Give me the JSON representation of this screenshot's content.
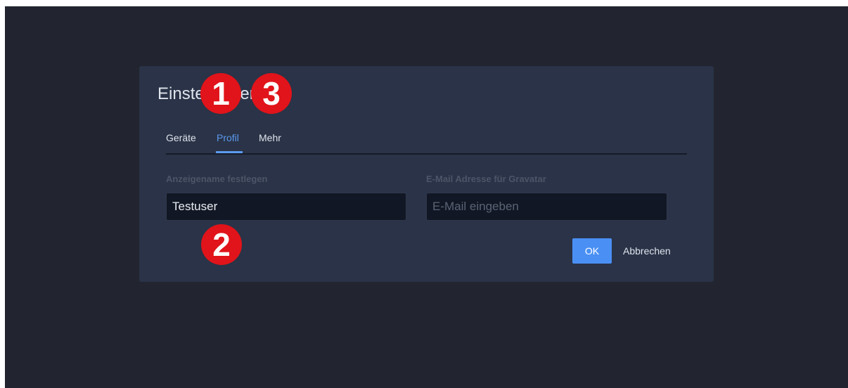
{
  "dialog": {
    "title": "Einstellungen",
    "tabs": [
      {
        "label": "Geräte",
        "active": false
      },
      {
        "label": "Profil",
        "active": true
      },
      {
        "label": "Mehr",
        "active": false
      }
    ],
    "fields": {
      "name_label": "Anzeigename festlegen",
      "name_value": "Testuser",
      "email_label": "E-Mail Adresse für Gravatar",
      "email_placeholder": "E-Mail eingeben"
    },
    "buttons": {
      "ok_label": "OK",
      "cancel_label": "Abbrechen"
    }
  },
  "markers": [
    "1",
    "2",
    "3"
  ],
  "colors": {
    "background": "#22252f",
    "dialog": "#2a3347",
    "accent": "#4a90f4",
    "marker": "#e0141a"
  }
}
